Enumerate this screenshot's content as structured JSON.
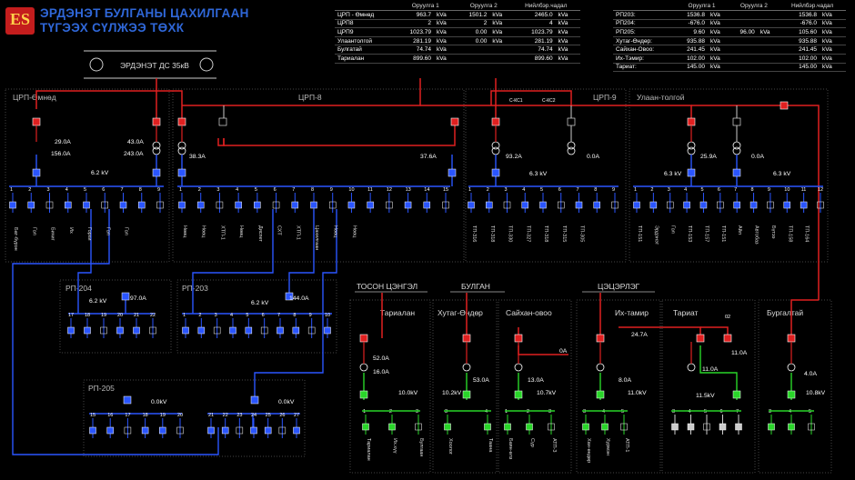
{
  "header": {
    "line1": "ЭРДЭНЭТ БУЛГАНЫ ЦАХИЛГААН",
    "line2": "ТҮГЭЭХ СҮЛЖЭЭ ТӨХК",
    "logo_text": "ES"
  },
  "table_left": {
    "cols": [
      "Оруулга 1",
      "Оруулга 2",
      "Нийлбэр.чадал"
    ],
    "rows": [
      {
        "name": "ЦРП - Өмнөд",
        "v1": "963.7",
        "u1": "kVa",
        "v2": "1501.2",
        "u2": "kVa",
        "v3": "2465.0",
        "u3": "kVa"
      },
      {
        "name": "ЦРП8",
        "v1": "2",
        "u1": "kVa",
        "v2": "2",
        "u2": "kVa",
        "v3": "4",
        "u3": "kVa"
      },
      {
        "name": "ЦРП9",
        "v1": "1023.79",
        "u1": "kVa",
        "v2": "0.00",
        "u2": "kVa",
        "v3": "1023.79",
        "u3": "kVa"
      },
      {
        "name": "Улаантолгой",
        "v1": "281.19",
        "u1": "kVa",
        "v2": "0.00",
        "u2": "kVa",
        "v3": "281.19",
        "u3": "kVa"
      },
      {
        "name": "Булгатай",
        "v1": "74.74",
        "u1": "kVa",
        "v2": "",
        "u2": "",
        "v3": "74.74",
        "u3": "kVa"
      },
      {
        "name": "Тариалан",
        "v1": "899.60",
        "u1": "kVa",
        "v2": "",
        "u2": "",
        "v3": "899.60",
        "u3": "kVa"
      }
    ]
  },
  "table_right": {
    "cols": [
      "Оруулга 1",
      "Оруулга 2",
      "Нийлбэр.чадал"
    ],
    "rows": [
      {
        "name": "РП203:",
        "v1": "1536.8",
        "u1": "kVa",
        "v2": "",
        "u2": "",
        "v3": "1536.8",
        "u3": "kVa"
      },
      {
        "name": "РП204:",
        "v1": "-676.0",
        "u1": "kVa",
        "v2": "",
        "u2": "",
        "v3": "-676.0",
        "u3": "kVa"
      },
      {
        "name": "РП205:",
        "v1": "9.60",
        "u1": "kVa",
        "v2": "96.00",
        "u2": "kVa",
        "v3": "105.60",
        "u3": "kVa"
      },
      {
        "name": "Хутаг-Өндөр:",
        "v1": "935.88",
        "u1": "kVa",
        "v2": "",
        "u2": "",
        "v3": "935.88",
        "u3": "kVa"
      },
      {
        "name": "Сайхан-Овоо:",
        "v1": "241.45",
        "u1": "kVa",
        "v2": "",
        "u2": "",
        "v3": "241.45",
        "u3": "kVa"
      },
      {
        "name": "Их-Тэмир:",
        "v1": "102.00",
        "u1": "kVa",
        "v2": "",
        "u2": "",
        "v3": "102.00",
        "u3": "kVa"
      },
      {
        "name": "Тариат:",
        "v1": "145.00",
        "u1": "kVa",
        "v2": "",
        "u2": "",
        "v3": "145.00",
        "u3": "kVa"
      }
    ]
  },
  "substation": {
    "name": "ЭРДЭНЭТ ДС 35кВ"
  },
  "sections": [
    {
      "id": "crp_omnod",
      "name": "ЦРП-Өмнөд"
    },
    {
      "id": "crp8",
      "name": "ЦРП-8"
    },
    {
      "id": "crp9",
      "name": "ЦРП-9"
    },
    {
      "id": "ulaantolgoi",
      "name": "Улаан-толгой"
    },
    {
      "id": "rp204",
      "name": "РП-204"
    },
    {
      "id": "rp203",
      "name": "РП-203"
    },
    {
      "id": "rp205",
      "name": "РП-205"
    }
  ],
  "regions": {
    "toson": "ТОСОН ЦЭНГЭЛ",
    "bulgan": "БУЛГАН",
    "tsetserleg": "ЦЭЦЭРЛЭГ",
    "tarialan": "Тариалан",
    "khutag": "Хутаг-Өндөр",
    "saikhan": "Сайхан-овоо",
    "ikh_tamir": "Их-тамир",
    "tariat": "Тариат",
    "bulgatai": "Бургалтай"
  },
  "readings": {
    "omnod_a1": "29.0A",
    "omnod_a2": "156.0A",
    "omnod_b1": "43.0A",
    "omnod_b2": "243.0A",
    "omnod_kv": "6.2 kV",
    "crp8_a": "38.3A",
    "crp8_b": "37.6A",
    "crp9_a": "93.2A",
    "crp9_kv": "6.3 kV",
    "crp9_b": "0.0A",
    "crp9_kc1": "С-КС1",
    "crp9_kc2": "С-КС2",
    "ul_a": "25.9A",
    "ul_kv1": "6.3 kV",
    "ul_b": "0.0A",
    "ul_kv2": "6.3 kV",
    "rp204_kv": "6.2 kV",
    "rp204_a": "97.0A",
    "rp203_kv": "6.2 kV",
    "rp203_a": "144.0A",
    "rp205_kv1": "0.0kV",
    "rp205_kv2": "0.0kV",
    "tar_a1": "52.0A",
    "tar_a2": "16.0A",
    "tar_kv": "10.0kV",
    "khu_kv": "10.2kV",
    "khu_a": "53.0A",
    "sai_a": "13.0A",
    "sai_kv": "10.7kV",
    "sai_b": "0A",
    "ikh_a1": "24.7A",
    "ikh_a2": "8.0A",
    "ikh_kv": "11.0kV",
    "tariat_02": "02",
    "tariat_a1": "11.0A",
    "tariat_a2": "11.0A",
    "tariat_kv": "11.5kV",
    "bul_a": "4.0A",
    "bul_kv": "10.8kV"
  },
  "feeders": {
    "omnod": [
      "Бат-бүрэн",
      "Гол",
      "Бичиг",
      "Их",
      "Горхи",
      "Гол",
      "Гол"
    ],
    "crp8": [
      "Нөөц",
      "Нөөц",
      "ХТП-1",
      "Нөөц",
      "Диспет",
      "СХТ",
      "ХТП-1",
      "Цахилгаан",
      "Нөөц",
      "Нөөц"
    ],
    "crp9": [
      "ТП-316",
      "ТП-318",
      "ТП-330",
      "ТП-327",
      "ТП-318",
      "ТП-315",
      "ТП-305"
    ],
    "ulaantolgoi": [
      "ТП-151",
      "Эрдэнэт",
      "Гол",
      "ТП-153",
      "ТП-157",
      "ТП-151",
      "Айл",
      "Автобаз",
      "Бүтээ",
      "ТП-158",
      "ТП-164"
    ],
    "tar": [
      "Тариалан",
      "Их.хүү",
      "Булгаан"
    ],
    "khu": [
      "Хоолог",
      "Таана"
    ],
    "sai": [
      "Баян-өлз",
      "Сүр",
      "АТП-3"
    ],
    "ikh": [
      "Хан-өндөр",
      "Хурмэн",
      "АТП-1"
    ]
  }
}
